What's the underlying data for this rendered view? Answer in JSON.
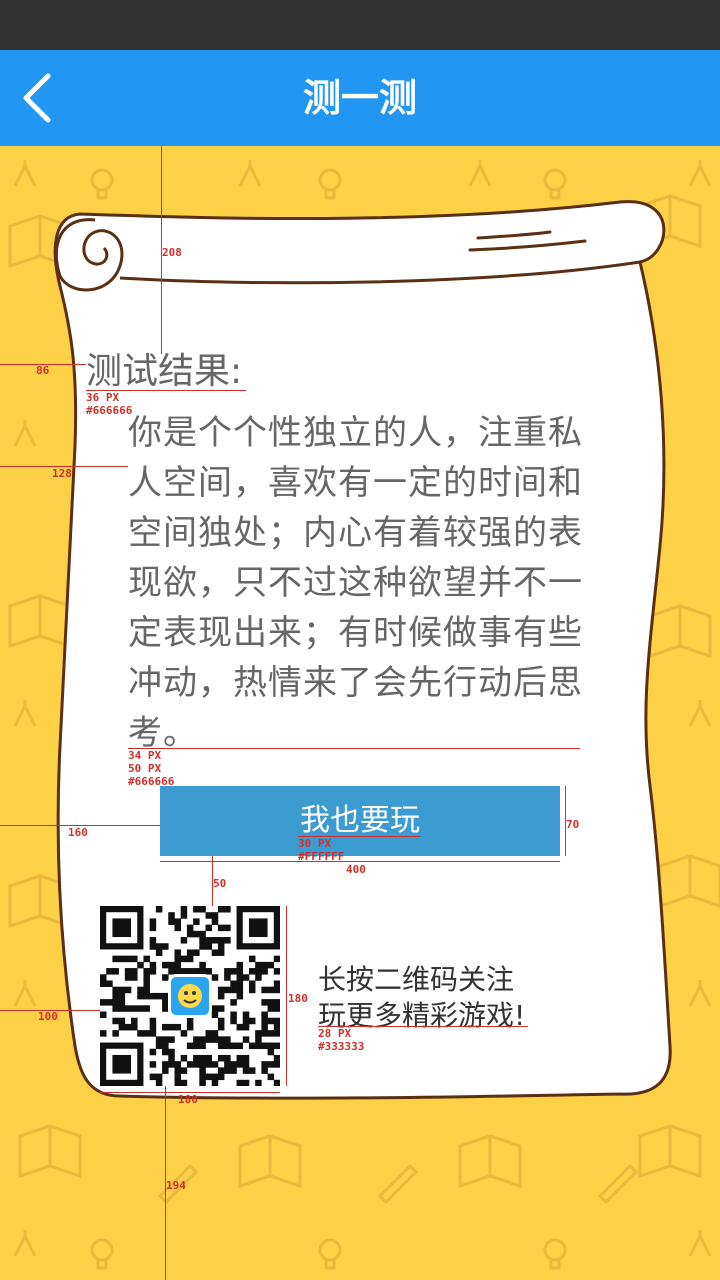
{
  "nav": {
    "title": "测一测",
    "back_icon": "chevron-left-icon"
  },
  "result": {
    "title": "测试结果:",
    "text": "你是个个性独立的人，注重私人空间，喜欢有一定的时间和空间独处；内心有着较强的表现欲，只不过这种欲望并不一定表现出来；有时候做事有些冲动，热情来了会先行动后思考。"
  },
  "play_button": {
    "label": "我也要玩"
  },
  "qr": {
    "line1": "长按二维码关注",
    "line2": "玩更多精彩游戏!"
  },
  "annotations": {
    "top_gap": "208",
    "title_left": "86",
    "title_spec_size": "36 PX",
    "title_spec_color": "#666666",
    "text_left": "128",
    "text_spec_size": "34 PX",
    "text_spec_line": "50 PX",
    "text_spec_color": "#666666",
    "button_left": "160",
    "button_height": "70",
    "button_spec_size": "30 PX",
    "button_spec_color": "#FFFFFF",
    "button_width": "400",
    "button_gap": "50",
    "qr_left": "100",
    "qr_height": "180",
    "qr_width": "180",
    "qr_spec_size": "28 PX",
    "qr_spec_color": "#333333",
    "bottom_gap": "194"
  },
  "colors": {
    "status_bar": "#333333",
    "nav_bar": "#2196f3",
    "background": "#fdd146",
    "scroll_fill": "#ffffff",
    "scroll_stroke": "#5a2f14",
    "button": "#3c9bd0",
    "text": "#666666",
    "annotation": "#d0302a"
  }
}
